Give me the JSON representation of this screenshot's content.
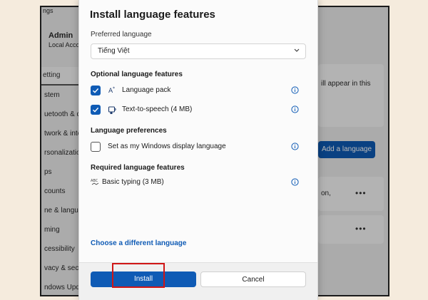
{
  "background": {
    "settings_fragment": "ngs",
    "user_name": "Admin",
    "account_type": "Local Accou",
    "search_placeholder": "etting",
    "nav_items": [
      "stem",
      "uetooth & de",
      "twork & inte",
      "rsonalizatio",
      "ps",
      "counts",
      "ne & langua",
      "ming",
      "cessibility",
      "vacy & secu",
      "ndows Upda"
    ],
    "card_text": "ill appear in this",
    "add_language_label": "Add a language",
    "card2_text": "on,",
    "more_label": "•••"
  },
  "dialog": {
    "title": "Install language features",
    "preferred_language_label": "Preferred language",
    "preferred_language_value": "Tiếng Việt",
    "optional_header": "Optional language features",
    "optional_items": [
      {
        "label": "Language pack",
        "checked": true,
        "icon": "language-pack-icon"
      },
      {
        "label": "Text-to-speech (4 MB)",
        "checked": true,
        "icon": "speech-icon"
      }
    ],
    "preferences_header": "Language preferences",
    "display_language_label": "Set as my Windows display language",
    "display_language_checked": false,
    "required_header": "Required language features",
    "required_item": "Basic typing (3 MB)",
    "choose_link": "Choose a different language",
    "install_label": "Install",
    "cancel_label": "Cancel"
  },
  "colors": {
    "accent": "#0f5bb5",
    "highlight": "#d01616",
    "backdrop": "#f5ebdd"
  }
}
